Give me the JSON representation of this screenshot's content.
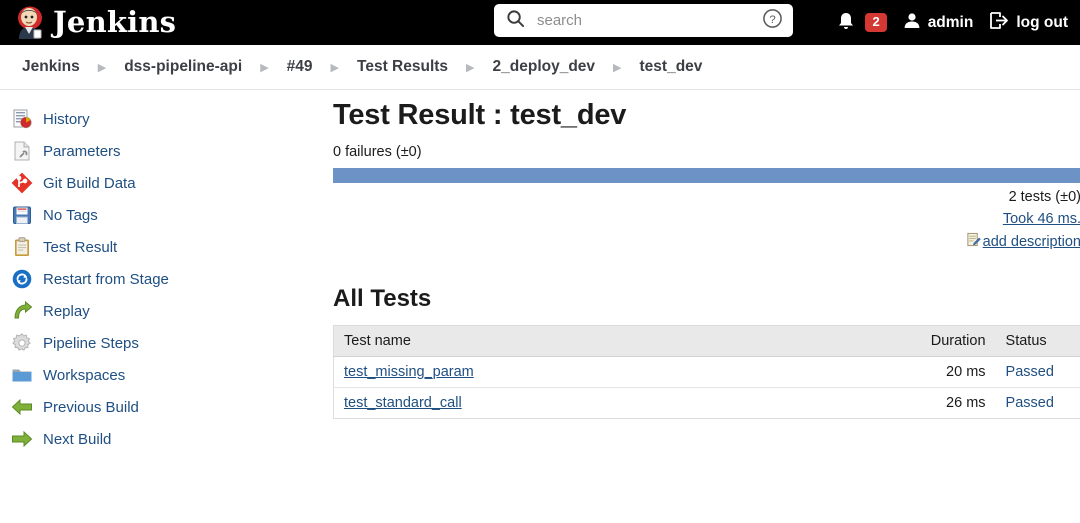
{
  "header": {
    "brand_label": "Jenkins",
    "logo_icon": "jenkins-butler-logo",
    "search": {
      "icon": "search-icon",
      "placeholder": "search",
      "value": "",
      "help_icon": "help-circle-icon"
    },
    "notifications": {
      "icon": "bell-icon",
      "count": "2",
      "badge_color": "#d33833"
    },
    "user": {
      "icon": "person-icon",
      "label": "admin"
    },
    "logout": {
      "icon": "logout-arrow-icon",
      "label": "log out"
    }
  },
  "breadcrumb": {
    "separator_icon": "chevron-right-icon",
    "items": [
      {
        "label": "Jenkins"
      },
      {
        "label": "dss-pipeline-api"
      },
      {
        "label": "#49"
      },
      {
        "label": "Test Results"
      },
      {
        "label": "2_deploy_dev"
      },
      {
        "label": "test_dev"
      }
    ]
  },
  "sidebar": {
    "items": [
      {
        "label": "History",
        "icon": "history-chart-icon"
      },
      {
        "label": "Parameters",
        "icon": "parameters-document-icon"
      },
      {
        "label": "Git Build Data",
        "icon": "git-diamond-icon"
      },
      {
        "label": "No Tags",
        "icon": "floppy-disk-icon"
      },
      {
        "label": "Test Result",
        "icon": "clipboard-icon"
      },
      {
        "label": "Restart from Stage",
        "icon": "restart-circle-icon"
      },
      {
        "label": "Replay",
        "icon": "replay-arrow-icon"
      },
      {
        "label": "Pipeline Steps",
        "icon": "gear-icon"
      },
      {
        "label": "Workspaces",
        "icon": "folder-icon"
      },
      {
        "label": "Previous Build",
        "icon": "arrow-left-icon"
      },
      {
        "label": "Next Build",
        "icon": "arrow-right-icon"
      }
    ]
  },
  "main": {
    "page_title": "Test Result : test_dev",
    "failures_text": "0 failures (±0)",
    "progress": {
      "percent": 100,
      "color": "#6d93c6"
    },
    "tests_count_text": "2 tests (±0)",
    "took_text": "Took 46 ms.",
    "add_description": {
      "icon": "edit-note-icon",
      "label": "add description"
    },
    "all_tests_title": "All Tests",
    "table": {
      "columns": [
        "Test name",
        "Duration",
        "Status"
      ],
      "rows": [
        {
          "name": "test_missing_param",
          "duration": "20 ms",
          "status": "Passed"
        },
        {
          "name": "test_standard_call",
          "duration": "26 ms",
          "status": "Passed"
        }
      ]
    }
  }
}
